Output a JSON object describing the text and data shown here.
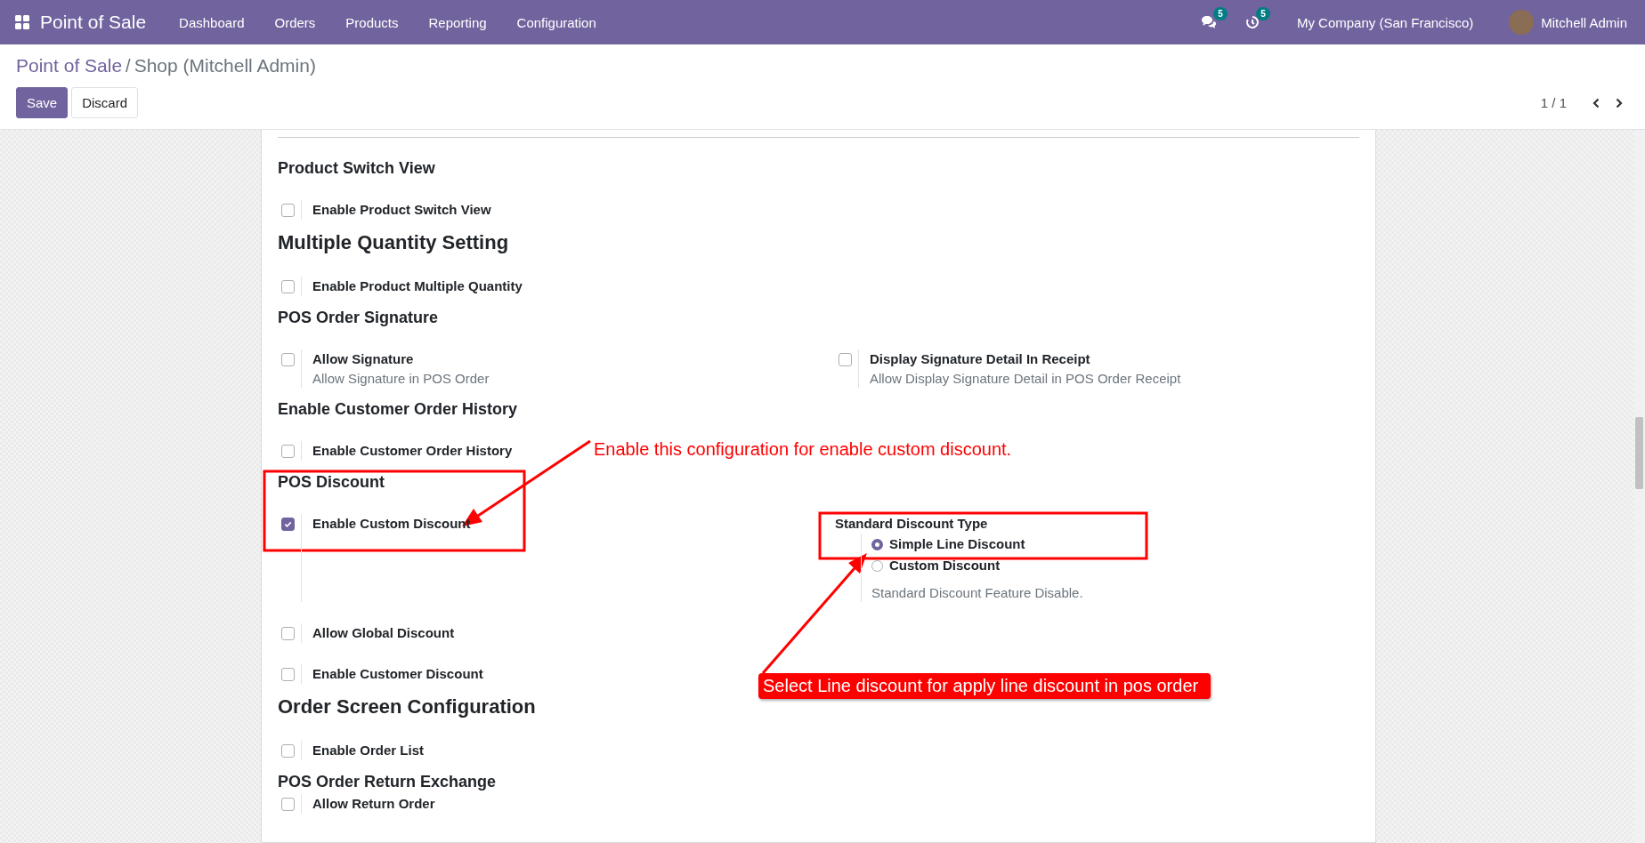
{
  "navbar": {
    "app_name": "Point of Sale",
    "menu": [
      "Dashboard",
      "Orders",
      "Products",
      "Reporting",
      "Configuration"
    ],
    "messages_badge": "5",
    "activities_badge": "5",
    "company": "My Company (San Francisco)",
    "user": "Mitchell Admin"
  },
  "breadcrumb": {
    "parent": "Point of Sale",
    "separator": "/",
    "current": "Shop (Mitchell Admin)"
  },
  "buttons": [
    {
      "label": "Save",
      "kind": "primary"
    },
    {
      "label": "Discard",
      "kind": "secondary"
    }
  ],
  "pager": "1 / 1",
  "sections": [
    {
      "title": "Product Switch View",
      "kind": "subheading",
      "settings": [
        {
          "label": "Enable Product Switch View",
          "checked": false
        }
      ]
    },
    {
      "title": "Multiple Quantity Setting",
      "kind": "heading",
      "settings": [
        {
          "label": "Enable Product Multiple Quantity",
          "checked": false
        }
      ]
    },
    {
      "title": "POS Order Signature",
      "kind": "subheading",
      "settings": [
        {
          "label": "Allow Signature",
          "description": "Allow Signature in POS Order",
          "checked": false,
          "right": {
            "kind": "checkbox",
            "label": "Display Signature Detail In Receipt",
            "description": "Allow Display Signature Detail in POS Order Receipt",
            "checked": false
          }
        }
      ]
    },
    {
      "title": "Enable Customer Order History",
      "kind": "subheading",
      "settings": [
        {
          "label": "Enable Customer Order History",
          "checked": false
        }
      ]
    },
    {
      "title": "POS Discount",
      "kind": "subheading",
      "settings": [
        {
          "label": "Enable Custom Discount",
          "checked": true,
          "right": {
            "kind": "radio_group",
            "title": "Standard Discount Type",
            "options": [
              {
                "label": "Simple Line Discount",
                "selected": true
              },
              {
                "label": "Custom Discount",
                "selected": false
              }
            ],
            "description": "Standard Discount Feature Disable."
          }
        },
        {
          "label": "Allow Global Discount",
          "checked": false
        },
        {
          "label": "Enable Customer Discount",
          "checked": false
        }
      ]
    },
    {
      "title": "Order Screen Configuration",
      "kind": "heading",
      "settings": [
        {
          "label": "Enable Order List",
          "checked": false
        }
      ]
    },
    {
      "title": "POS Order Return Exchange",
      "kind": "subheading",
      "settings": [
        {
          "label": "Allow Return Order",
          "checked": false
        }
      ]
    }
  ],
  "annotations": [
    {
      "kind": "note",
      "text": "Enable this configuration for enable custom discount."
    },
    {
      "kind": "callout",
      "text": "Select Line discount for apply line discount in pos order"
    }
  ]
}
